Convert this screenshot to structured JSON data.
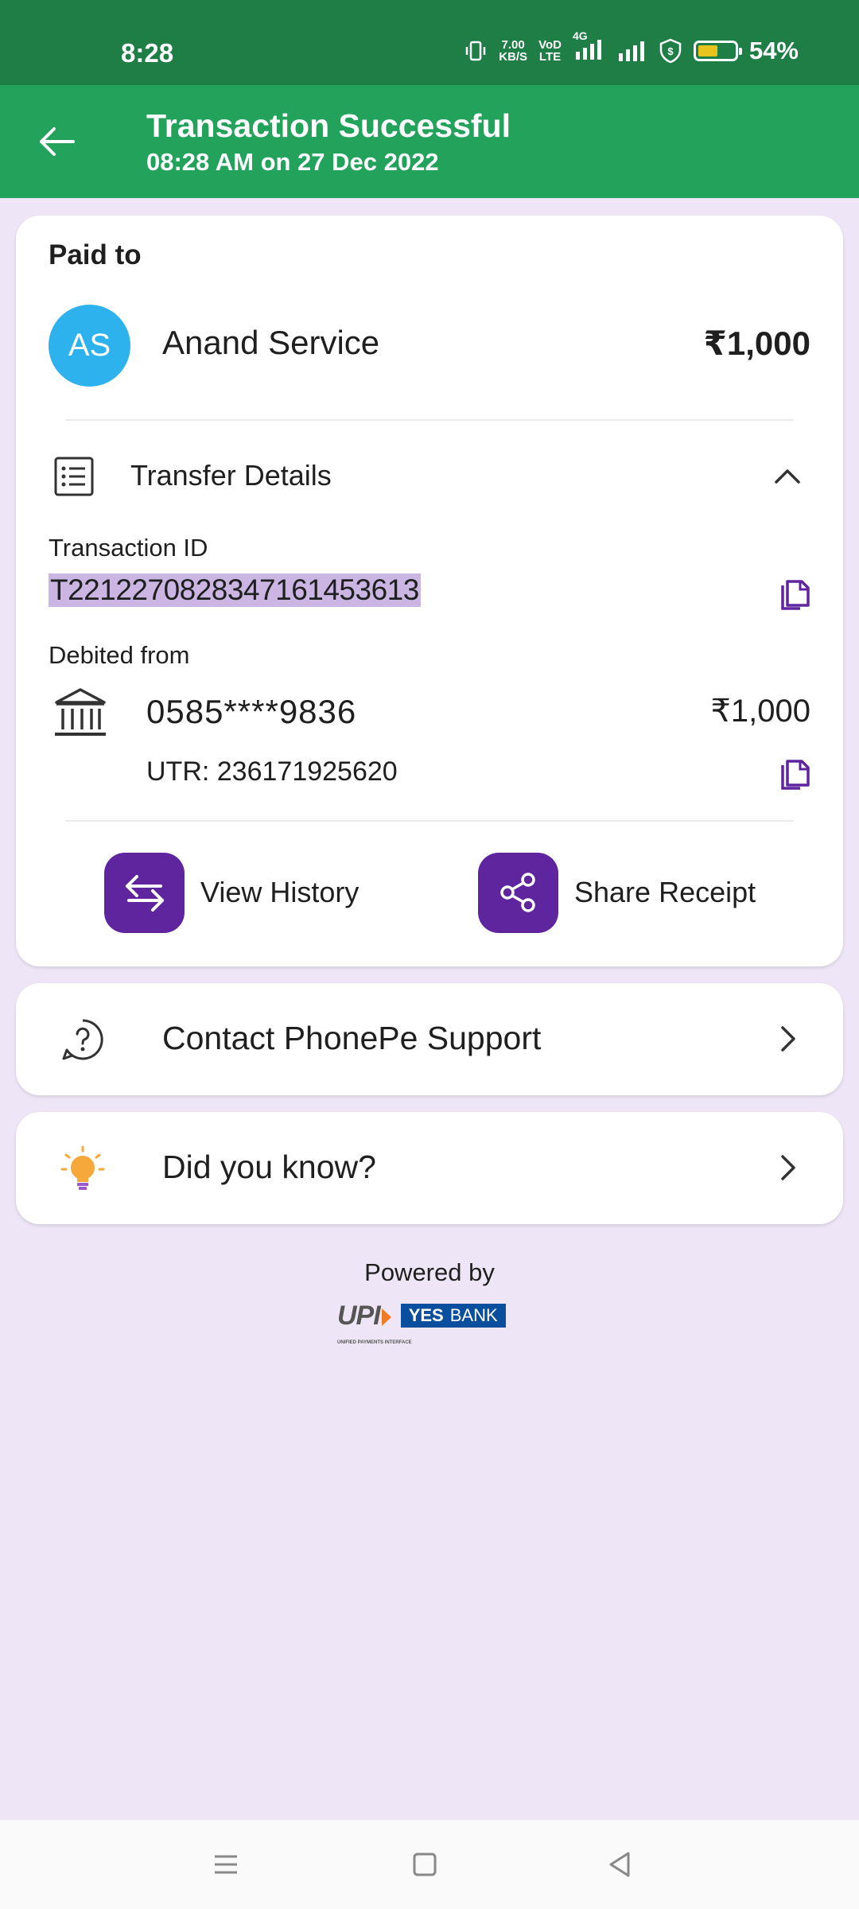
{
  "status_bar": {
    "time": "8:28",
    "net_speed_value": "7.00",
    "net_speed_unit": "KB/S",
    "volte_top": "VoD",
    "volte_bottom": "LTE",
    "network": "4G",
    "battery_percent": "54%",
    "battery_level": 0.54
  },
  "header": {
    "title": "Transaction Successful",
    "subtitle": "08:28 AM on 27 Dec 2022",
    "accent_color": "#22a25a"
  },
  "paid_to": {
    "label": "Paid to",
    "avatar_initials": "AS",
    "name": "Anand Service",
    "amount": "₹1,000"
  },
  "transfer_details": {
    "label": "Transfer Details",
    "transaction_id_label": "Transaction ID",
    "transaction_id": "T2212270828347161453613",
    "debited_from_label": "Debited from",
    "account_number": "0585****9836",
    "account_amount": "₹1,000",
    "utr": "UTR: 236171925620"
  },
  "actions": {
    "view_history": "View History",
    "share_receipt": "Share Receipt",
    "icon_bg": "#5f259f"
  },
  "support": {
    "label": "Contact PhonePe Support"
  },
  "did_you_know": {
    "label": "Did you know?"
  },
  "footer": {
    "powered_by": "Powered by",
    "upi_text": "UPI",
    "upi_tagline": "UNIFIED PAYMENTS INTERFACE",
    "bank_yes": "YES",
    "bank_name": "BANK"
  }
}
